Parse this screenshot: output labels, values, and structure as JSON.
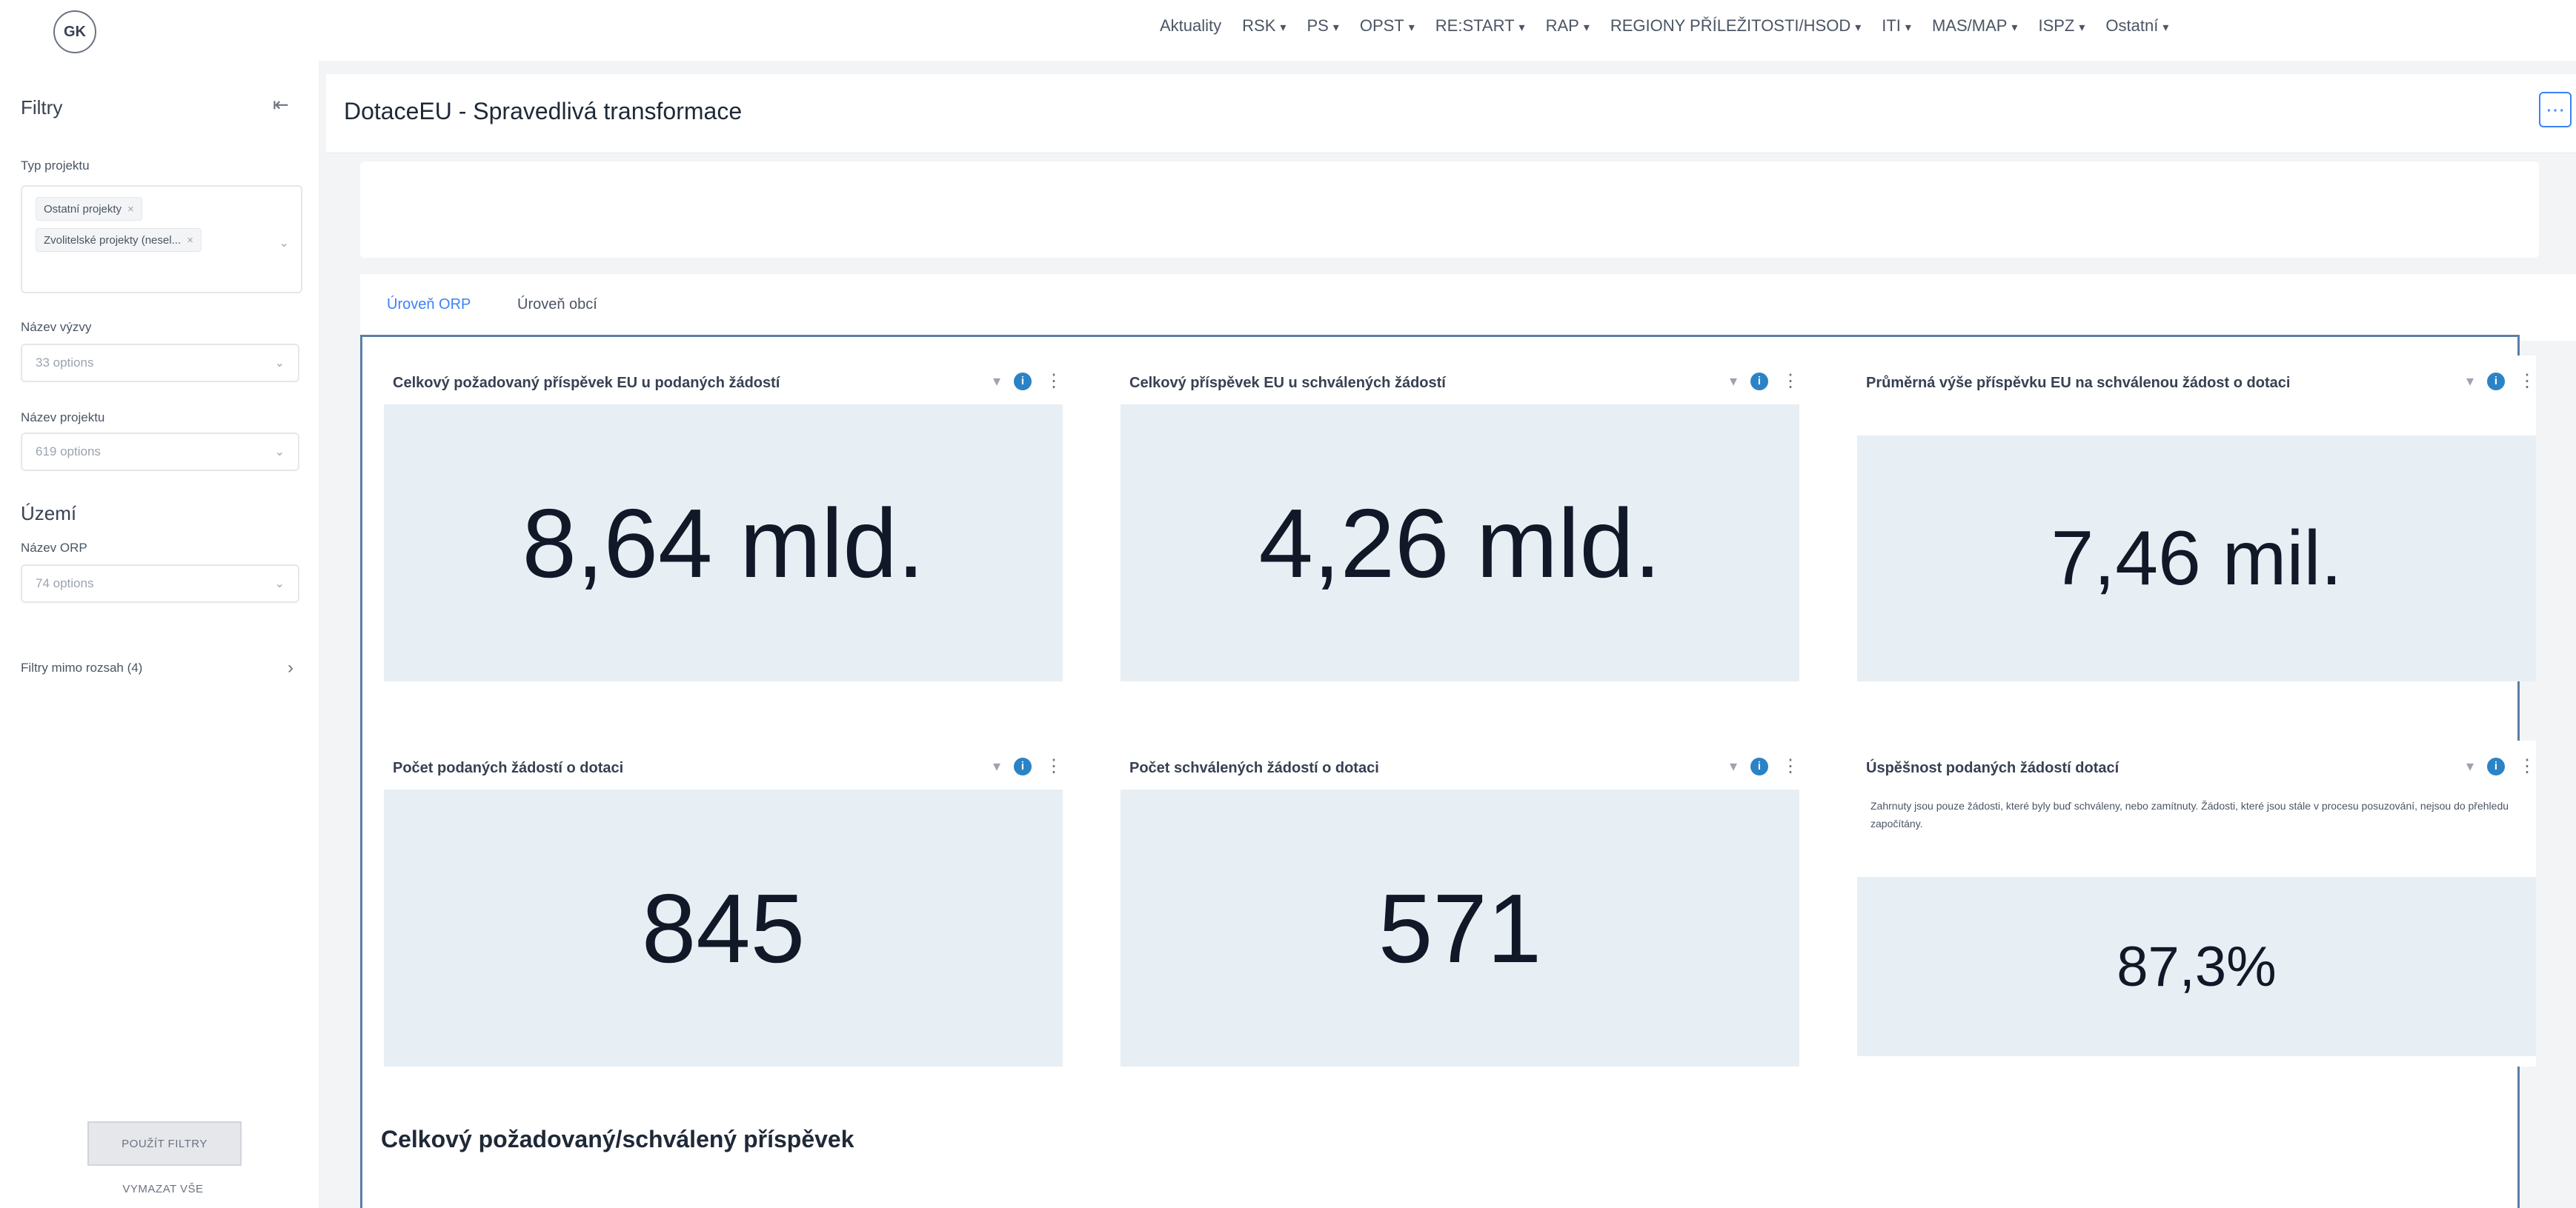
{
  "logo_text": "GK",
  "nav": {
    "items": [
      {
        "label": "Aktuality",
        "dropdown": false
      },
      {
        "label": "RSK",
        "dropdown": true
      },
      {
        "label": "PS",
        "dropdown": true
      },
      {
        "label": "OPST",
        "dropdown": true
      },
      {
        "label": "RE:START",
        "dropdown": true
      },
      {
        "label": "RAP",
        "dropdown": true
      },
      {
        "label": "REGIONY PŘÍLEŽITOSTI/HSOD",
        "dropdown": true
      },
      {
        "label": "ITI",
        "dropdown": true
      },
      {
        "label": "MAS/MAP",
        "dropdown": true
      },
      {
        "label": "ISPZ",
        "dropdown": true
      },
      {
        "label": "Ostatní",
        "dropdown": true
      }
    ]
  },
  "sidebar": {
    "title": "Filtry",
    "project_type_label": "Typ projektu",
    "project_type_chips": [
      "Ostatní projekty",
      "Zvolitelské projekty (nesel..."
    ],
    "call_label": "Název výzvy",
    "call_placeholder": "33 options",
    "project_name_label": "Název projektu",
    "project_name_placeholder": "619 options",
    "territory_heading": "Území",
    "orp_label": "Název ORP",
    "orp_placeholder": "74 options",
    "more_filters": "Filtry mimo rozsah (4)",
    "apply_button": "POUŽÍT FILTRY",
    "clear_button": "VYMAZAT VŠE"
  },
  "page": {
    "title": "DotaceEU - Spravedlivá transformace"
  },
  "tabs": [
    {
      "label": "Úroveň ORP",
      "active": true
    },
    {
      "label": "Úroveň obcí",
      "active": false
    }
  ],
  "kpis": [
    {
      "title": "Celkový požadovaný příspěvek EU u podaných žádostí",
      "value": "8,64 mld.",
      "description": ""
    },
    {
      "title": "Celkový příspěvek EU u schválených žádostí",
      "value": "4,26 mld.",
      "description": ""
    },
    {
      "title": "Průměrná výše příspěvku EU na schválenou žádost o dotaci",
      "value": "7,46 mil.",
      "description": ""
    },
    {
      "title": "Počet podaných žádostí o dotaci",
      "value": "845",
      "description": ""
    },
    {
      "title": "Počet schválených žádostí o dotaci",
      "value": "571",
      "description": ""
    },
    {
      "title": "Úspěšnost podaných žádostí dotací",
      "value": "87,3%",
      "description": "Zahrnuty jsou pouze žádosti, které byly buď schváleny, nebo zamítnuty. Žádosti, které jsou stále v procesu posuzování, nejsou do přehledu započítány."
    }
  ],
  "section_title": "Celkový požadovaný/schválený příspěvek",
  "colors": {
    "accent": "#3b82f6",
    "kpi_background": "#e8eff4",
    "info_icon": "#2b83c6",
    "page_background": "#f3f4f6"
  }
}
